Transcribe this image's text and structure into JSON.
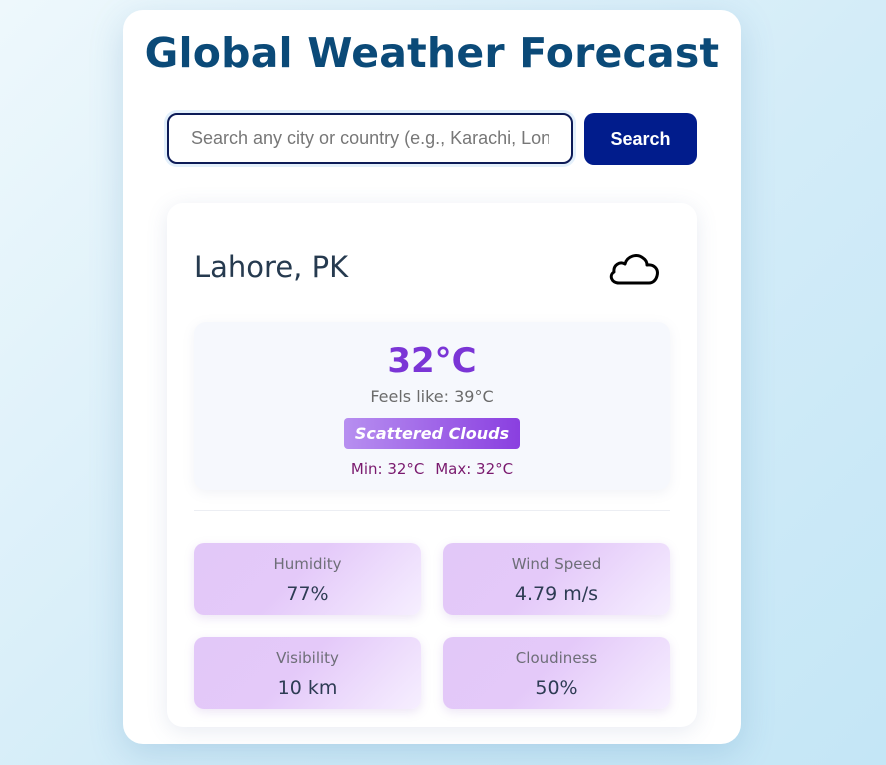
{
  "app": {
    "title": "Global Weather Forecast"
  },
  "search": {
    "placeholder": "Search any city or country (e.g., Karachi, London, Paris)",
    "value": "",
    "button_label": "Search"
  },
  "weather": {
    "location": "Lahore, PK",
    "icon": "cloud-icon",
    "temperature": "32°C",
    "feels_like": "Feels like: 39°C",
    "condition": "Scattered Clouds",
    "min": "Min: 32°C",
    "max": "Max: 32°C",
    "stats": [
      {
        "label": "Humidity",
        "value": "77%"
      },
      {
        "label": "Wind Speed",
        "value": "4.79 m/s"
      },
      {
        "label": "Visibility",
        "value": "10 km"
      },
      {
        "label": "Cloudiness",
        "value": "50%"
      }
    ]
  },
  "colors": {
    "title": "#0b4a78",
    "button": "#011c8c",
    "temperature": "#7b35d6",
    "badge_start": "#b78ff0",
    "badge_end": "#8a3fe0",
    "min_max": "#7a1a6e"
  }
}
